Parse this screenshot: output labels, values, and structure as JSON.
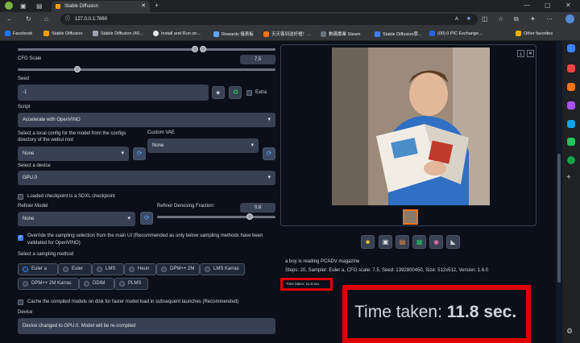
{
  "browser": {
    "tab_title": "Stable Diffusion",
    "url": "127.0.0.1:7860",
    "bookmarks": [
      "Facebook",
      "Stable Diffusion",
      "Stable Diffusion (40...",
      "Install and Run on...",
      "Rewards 儀表板",
      "天天客到送好禮！...",
      "數碼專業 Steam",
      "Stable Diffusion學...",
      "(00) 0 PIC Exchange...",
      "Other favorites"
    ]
  },
  "settings": {
    "cfg_label": "CFG Scale",
    "cfg_value": "7.5",
    "seed_label": "Seed",
    "seed_value": "-1",
    "extra_label": "Extra",
    "script_label": "Script",
    "script_value": "Accelerate with OpenVINO",
    "config_label": "Select a local config for the model from the configs directory of the webui root",
    "config_value": "None",
    "vae_label": "Custom VAE",
    "vae_value": "None",
    "device_label": "Select a device",
    "device_value": "GPU.0",
    "sdxl_label": "Loaded checkpoint is a SDXL checkpoint",
    "refiner_label": "Refiner Model",
    "refiner_value": "None",
    "refiner_frac_label": "Refiner Denosing Fraction:",
    "refiner_frac_value": "0.8",
    "override_label": "Override the sampling selection from the main UI (Recommended as only below sampling methods have been validated for OpenVINO)",
    "sampling_label": "Select a sampling method",
    "samplers": [
      "Euler a",
      "Euler",
      "LMS",
      "Heun",
      "DPM++ 2M",
      "LMS Karras",
      "DPM++ 2M Karras",
      "DDIM",
      "PLMS"
    ],
    "cache_label": "Cache the compiled models on disk for faster model load in subsequent launches (Recommended)",
    "device_out_label": "Device",
    "device_out_value": "Device changed to GPU.0. Model will be re-compiled"
  },
  "output": {
    "prompt": "a boy is reading PCADV magazine",
    "params": "Steps: 20, Sampler: Euler a, CFG scale: 7.5, Seed: 1392800450, Size: 512x512, Version: 1.6.0",
    "time_small": "Time taken: 11.8 sec.",
    "time_prefix": "Time taken: ",
    "time_value": "11.8 sec."
  },
  "colors": {
    "accent": "#3b82f6",
    "highlight": "#e00000"
  }
}
